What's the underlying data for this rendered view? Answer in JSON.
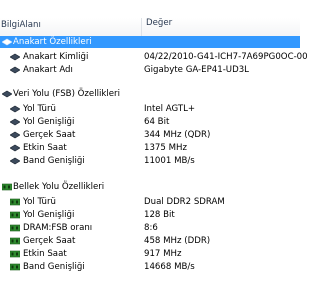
{
  "header": {
    "col1": "BilgiAlanı",
    "col2": "Değer"
  },
  "sections": {
    "anakart": {
      "title": "Anakart Özellikleri",
      "rows": [
        {
          "label": "Anakart Kimliği",
          "value": "04/22/2010-G41-ICH7-7A69PG0OC-00"
        },
        {
          "label": "Anakart Adı",
          "value": "Gigabyte GA-EP41-UD3L"
        }
      ]
    },
    "fsb": {
      "title": "Veri Yolu (FSB) Özellikleri",
      "rows": [
        {
          "label": "Yol Türü",
          "value": "Intel AGTL+"
        },
        {
          "label": "Yol Genişliği",
          "value": "64 Bit"
        },
        {
          "label": "Gerçek Saat",
          "value": "344 MHz (QDR)"
        },
        {
          "label": "Etkin Saat",
          "value": "1375 MHz"
        },
        {
          "label": "Band Genişliği",
          "value": "11001 MB/s"
        }
      ]
    },
    "bellek": {
      "title": "Bellek Yolu Özellikleri",
      "rows": [
        {
          "label": "Yol Türü",
          "value": "Dual DDR2 SDRAM"
        },
        {
          "label": "Yol Genişliği",
          "value": "128 Bit"
        },
        {
          "label": "DRAM:FSB oranı",
          "value": "8:6"
        },
        {
          "label": "Gerçek Saat",
          "value": "458 MHz (DDR)"
        },
        {
          "label": "Etkin Saat",
          "value": "917 MHz"
        },
        {
          "label": "Band Genişliği",
          "value": "14668 MB/s"
        }
      ]
    }
  },
  "colors": {
    "selection": "#3399ff",
    "icon_green": "#2f8a2f"
  }
}
